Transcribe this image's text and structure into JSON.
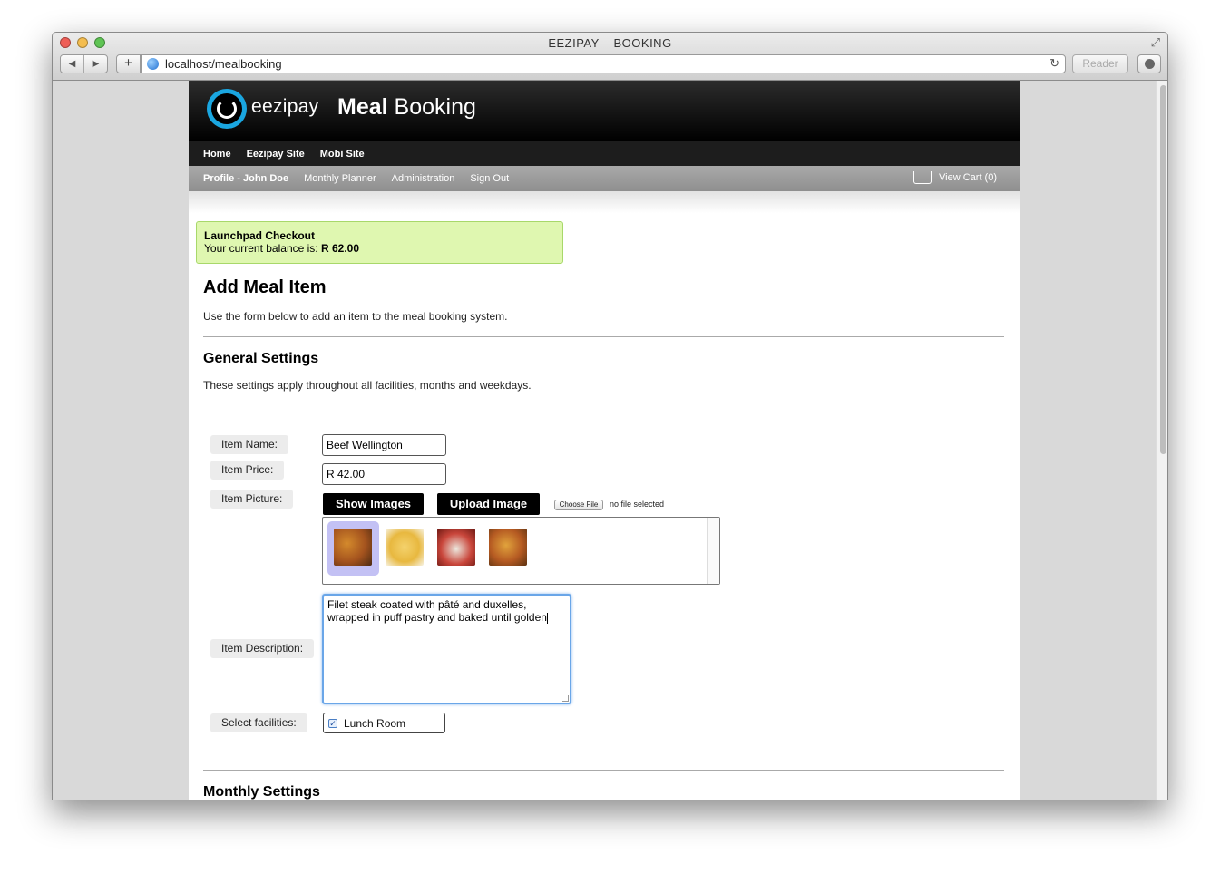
{
  "window": {
    "title": "EEZIPAY – BOOKING",
    "url": "localhost/mealbooking",
    "reader_label": "Reader",
    "add_label": "+",
    "back_glyph": "◀",
    "forward_glyph": "▶",
    "reload_glyph": "↻",
    "fullscreen_glyph": "⤢"
  },
  "header": {
    "brand": "eezipay",
    "title_bold": "Meal",
    "title_rest": "Booking"
  },
  "topnav": {
    "items": [
      "Home",
      "Eezipay Site",
      "Mobi Site"
    ]
  },
  "subnav": {
    "items": [
      "Profile - John Doe",
      "Monthly Planner",
      "Administration",
      "Sign Out"
    ],
    "cart_label": "View Cart (0)"
  },
  "notice": {
    "title": "Launchpad Checkout",
    "balance_prefix": "Your current balance is: ",
    "balance_value": "R 62.00"
  },
  "main": {
    "heading": "Add Meal Item",
    "intro": "Use the form below to add an item to the meal booking system.",
    "general_heading": "General Settings",
    "general_desc": "These settings apply throughout all facilities, months and weekdays.",
    "monthly_heading": "Monthly Settings"
  },
  "form": {
    "item_name_label": "Item Name:",
    "item_name_value": "Beef Wellington",
    "item_price_label": "Item Price:",
    "item_price_value": "R 42.00",
    "item_picture_label": "Item Picture:",
    "show_images_label": "Show Images",
    "upload_image_label": "Upload Image",
    "choose_file_label": "Choose File",
    "no_file_text": "no file selected",
    "description_label": "Item Description:",
    "description_line1": "Filet steak coated with pâté and duxelles,",
    "description_line2": "wrapped in puff pastry and baked until golden",
    "facilities_label": "Select facilities:",
    "facility_name": "Lunch Room",
    "facility_checked_glyph": "✓"
  },
  "colors": {
    "notice_bg": "#dff7b0",
    "selected_thumb": "#c3c1f4",
    "logo_ring": "#1aa6e0"
  }
}
